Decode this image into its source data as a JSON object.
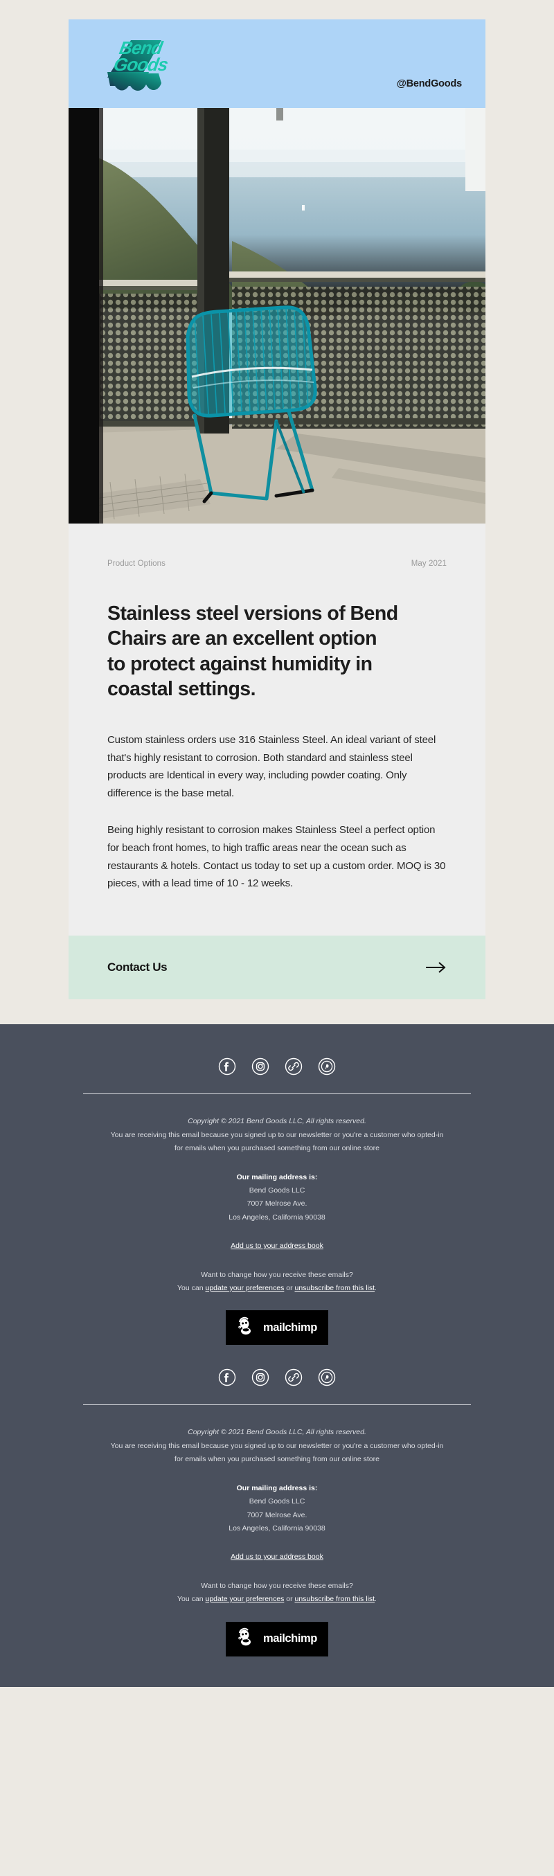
{
  "brand": {
    "logo_text_line1": "Bend",
    "logo_text_line2": "Goods",
    "handle": "@BendGoods",
    "header_bg": "#aed4f7",
    "logo_teal": "#1ecbb0",
    "logo_shadow": "#0b5f5c"
  },
  "hero": {
    "alt": "teal wire Bend chair on a balcony overlooking the ocean"
  },
  "article": {
    "category": "Product Options",
    "date": "May 2021",
    "headline": "Stainless steel versions of Bend Chairs are an excellent option to protect against humidity in coastal settings.",
    "paragraphs": [
      "Custom stainless orders use 316 Stainless Steel. An ideal variant of steel that's highly resistant to corrosion. Both standard and stainless steel products are Identical in every way, including powder coating. Only difference is the base metal.",
      "Being highly resistant to corrosion makes Stainless Steel a perfect option for beach front homes, to high traffic areas near the ocean such as restaurants & hotels. Contact us today to set up a custom order. MOQ is 30 pieces, with a lead time of 10 - 12 weeks."
    ]
  },
  "cta": {
    "label": "Contact Us",
    "arrow_icon": "arrow-right-icon",
    "background": "#d4e9dd"
  },
  "footer": {
    "background": "#4a505d",
    "social": [
      {
        "name": "facebook-icon",
        "glyph": "f"
      },
      {
        "name": "instagram-icon",
        "glyph": ""
      },
      {
        "name": "link-icon",
        "glyph": ""
      },
      {
        "name": "pinterest-icon",
        "glyph": "P"
      }
    ],
    "copyright": "Copyright © 2021 Bend Goods LLC, All rights reserved.",
    "optin_line1": "You are receiving this email because you signed up to our newsletter or you're a customer who opted-in",
    "optin_line2": "for emails when you purchased something from our online store",
    "address_heading": "Our mailing address is:",
    "address_line1": "Bend Goods LLC",
    "address_line2": "7007 Melrose Ave.",
    "address_line3": "Los Angeles, California 90038",
    "address_book_link": "Add us to your address book",
    "prefs_question": "Want to change how you receive these emails?",
    "prefs_prefix": "You can ",
    "prefs_link": "update your preferences",
    "prefs_middle": " or ",
    "unsub_link": "unsubscribe from this list",
    "prefs_suffix": ".",
    "mailchimp_label": "mailchimp"
  }
}
